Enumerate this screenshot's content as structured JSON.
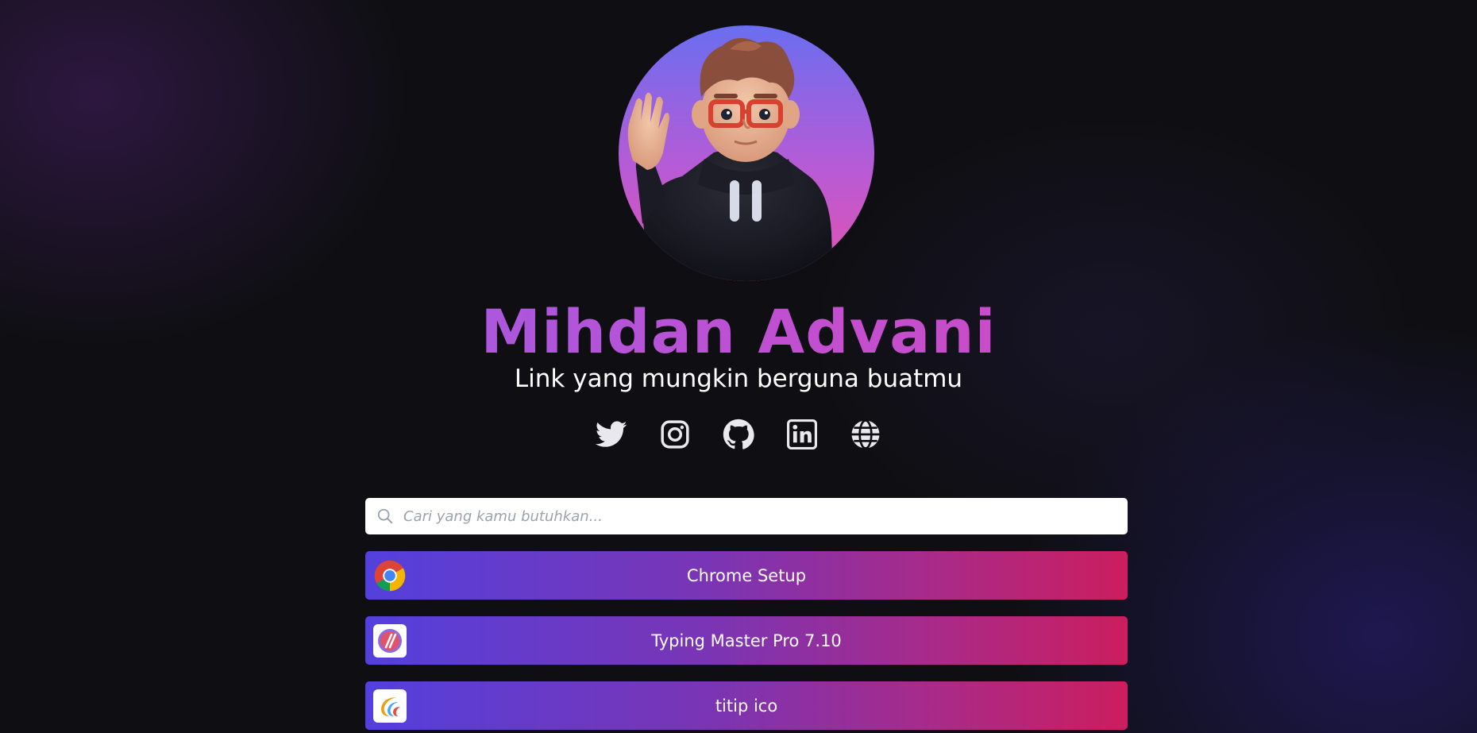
{
  "profile": {
    "name": "Mihdan Advani",
    "tagline": "Link yang mungkin berguna buatmu",
    "avatar_icon": "avatar-3d-character-icon"
  },
  "socials": [
    {
      "icon": "twitter-icon"
    },
    {
      "icon": "instagram-icon"
    },
    {
      "icon": "github-icon"
    },
    {
      "icon": "linkedin-icon"
    },
    {
      "icon": "globe-icon"
    }
  ],
  "search": {
    "placeholder": "Cari yang kamu butuhkan...",
    "value": ""
  },
  "links": [
    {
      "label": "Chrome Setup",
      "icon": "chrome-icon"
    },
    {
      "label": "Typing Master Pro 7.10",
      "icon": "typing-master-icon"
    },
    {
      "label": "titip ico",
      "icon": "titip-ico-icon"
    }
  ],
  "colors": {
    "background": "#0f0f13",
    "accent_start": "#5340dc",
    "accent_end": "#cb1e5e",
    "name_gradient_start": "#8a63f0",
    "name_gradient_end": "#d846b3"
  }
}
